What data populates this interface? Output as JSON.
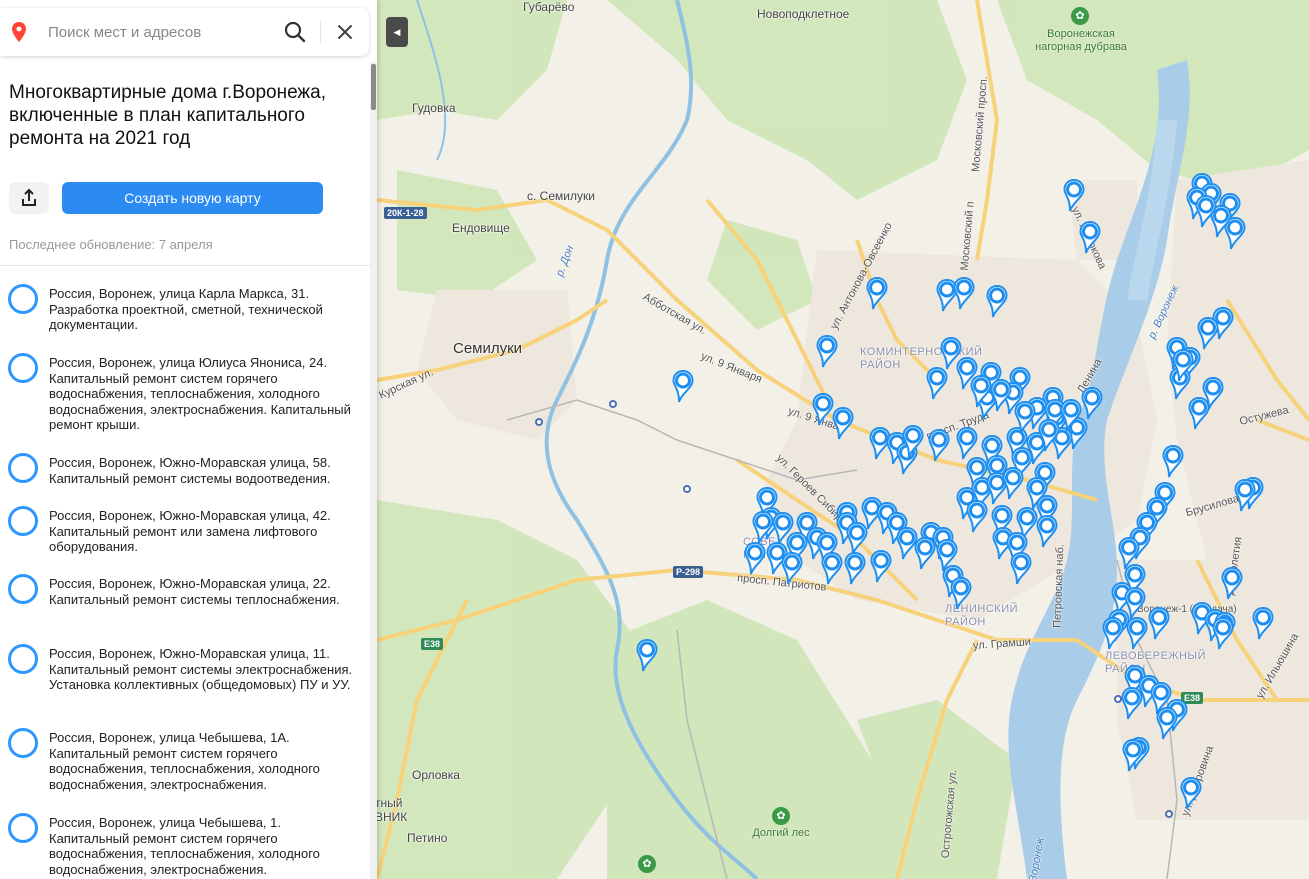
{
  "search": {
    "placeholder": "Поиск мест и адресов"
  },
  "title": "Многоквартирные дома г.Воронежа, включенные в план капитального ремонта на 2021 год",
  "create_button": "Создать новую карту",
  "last_update": "Последнее обновление: 7 апреля",
  "items": [
    {
      "text": "Россия, Воронеж, улица Карла Маркса, 31. Разработка проектной, сметной, технической документации."
    },
    {
      "text": "Россия, Воронеж, улица Юлиуса Янониса, 24. Капитальный ремонт систем горячего водоснабжения, теплоснабжения, холодного водоснабжения, электроснабжения. Капитальный ремонт крыши."
    },
    {
      "text": "Россия, Воронеж, Южно-Моравская улица, 58. Капитальный ремонт системы водоотведения."
    },
    {
      "text": "Россия, Воронеж, Южно-Моравская улица, 42. Капитальный ремонт или замена лифтового оборудования."
    },
    {
      "text": "Россия, Воронеж, Южно-Моравская улица, 22. Капитальный ремонт системы теплоснабжения."
    },
    {
      "text": "Россия, Воронеж, Южно-Моравская улица, 11. Капитальный ремонт системы электроснабжения. Установка коллективных (общедомовых) ПУ и УУ."
    },
    {
      "text": "Россия, Воронеж, улица Чебышева, 1А. Капитальный ремонт систем горячего водоснабжения, теплоснабжения, холодного водоснабжения, электроснабжения."
    },
    {
      "text": "Россия, Воронеж, улица Чебышева, 1. Капитальный ремонт систем горячего водоснабжения, теплоснабжения, холодного водоснабжения, электроснабжения."
    }
  ],
  "map": {
    "places": {
      "gubarevo": "Губарёво",
      "novopodkletnoe": "Новоподклетное",
      "gudovka": "Гудовка",
      "semiluki_s": "с. Семилуки",
      "endovishche": "Ендовище",
      "semiluki": "Семилуки",
      "orlovka": "Орловка",
      "petino": "Петино",
      "nik": "ВНИК",
      "nik_top": "тный"
    },
    "parks": {
      "dubrava": "Воронежская нагорная дубрава",
      "dolgiy_les": "Долгий лес"
    },
    "districts": {
      "kominternovsky": "КОМИНТЕРНОВСКИЙ РАЙОН",
      "leninsky": "ЛЕНИНСКИЙ РАЙОН",
      "levoberezhny": "ЛЕВОБЕРЕЖНЫЙ РАЙОН",
      "sovetsky": "СОВЕ РАЙОН"
    },
    "rivers": {
      "don": "р. Дон",
      "voronezh": "р. Воронеж",
      "voronezh_bottom": "р. Воронеж"
    },
    "roads": {
      "r20k": "20К-1-28",
      "p298": "Р-298",
      "e38a": "Е38",
      "e38b": "Е38",
      "abbatskaya": "Абботская ул.",
      "ul9jan": "ул. 9 Января",
      "ul9jan2": "ул. 9 Январ",
      "kurskaya": "Курская ул.",
      "antonova": "ул. Антонова-Овсеенко",
      "moskovsky": "Московский просп.",
      "moskovsky2": "Московский п",
      "geroev": "ул. Героев Сибир",
      "patriotov": "просп. Патриотов",
      "gramshi": "ул. Грамши",
      "truda": "просп. Труда",
      "lenina": "Ленина",
      "ostuzheva": "Остужева",
      "brusilova": "Брусилова",
      "ilyushina": "ул. Ильюшина",
      "dubrovina": "ул. Дубровина",
      "petrovskaya": "Петровская наб.",
      "ostrogozhskaya": "Острогожская ул.",
      "lizyukova": "ул. Лизюкова",
      "dolgoleta": "Долголетия",
      "voronezh_pridach": "Воронеж-1 (Придача)"
    }
  }
}
